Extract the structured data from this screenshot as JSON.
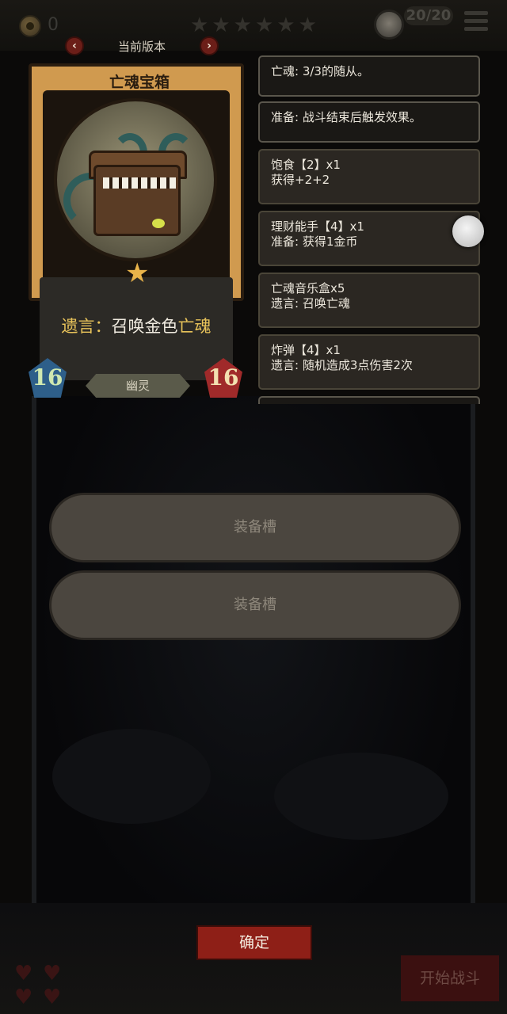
{
  "top_bar": {
    "gold": "0",
    "stars": [
      "★",
      "★",
      "★",
      "★",
      "★",
      "★"
    ],
    "turns": "20/20"
  },
  "card": {
    "version_label": "当前版本",
    "name": "亡魂宝箱",
    "description": {
      "prefix": "遗言：",
      "mid": "召唤金色",
      "keyword": "亡魂"
    },
    "tribe": "幽灵",
    "attack": "16",
    "health": "16"
  },
  "keyword_panels": [
    {
      "line1": "亡魂: 3/3的随从。",
      "line2": ""
    },
    {
      "line1": "准备: 战斗结束后触发效果。",
      "line2": ""
    },
    {
      "line1": "饱食【2】x1",
      "line2": "获得+2+2"
    },
    {
      "line1": "理财能手【4】x1",
      "line2": "准备: 获得1金币"
    },
    {
      "line1": "亡魂音乐盒x5",
      "line2": "遗言: 召唤亡魂"
    },
    {
      "line1": "炸弹【4】x1",
      "line2": "遗言: 随机造成3点伤害2次"
    }
  ],
  "slots": [
    "装备槽",
    "装备槽"
  ],
  "buttons": {
    "confirm": "确定",
    "start_fight": "开始战斗"
  },
  "colors": {
    "accent_red": "#8e1f17",
    "card_frame": "#d09a4f",
    "keyword_gold": "#e8c35a"
  }
}
